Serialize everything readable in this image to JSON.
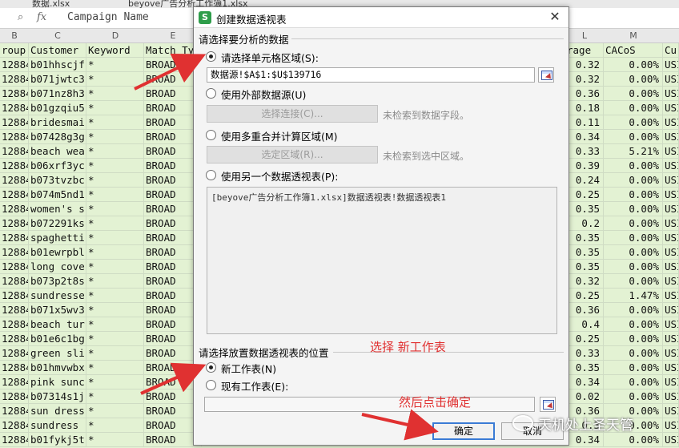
{
  "background": {
    "tabs": [
      "数据.xlsx",
      "beyove广告分析工作簿1.xlsx"
    ],
    "formula_bar": {
      "fx": "fx",
      "content": "Campaign Name"
    },
    "column_letters": [
      "B",
      "C",
      "D",
      "E",
      "L",
      "M"
    ],
    "header_row": [
      "roup",
      "Customer",
      "Keyword",
      "Match Ty",
      "rage",
      "CACoS",
      "Cu"
    ],
    "rows": [
      [
        "12884",
        "b01hhscjf",
        "*",
        "BROAD",
        "0.32",
        "0.00%",
        "USI"
      ],
      [
        "12884",
        "b071jwtc3",
        "*",
        "BROAD",
        "0.32",
        "0.00%",
        "USI"
      ],
      [
        "12884",
        "b071nz8h3",
        "*",
        "BROAD",
        "0.36",
        "0.00%",
        "USI"
      ],
      [
        "12884",
        "b01gzqiu5",
        "*",
        "BROAD",
        "0.18",
        "0.00%",
        "USI"
      ],
      [
        "12884",
        "bridesmai",
        "*",
        "BROAD",
        "0.11",
        "0.00%",
        "USI"
      ],
      [
        "12884",
        "b07428g3g",
        "*",
        "BROAD",
        "0.34",
        "0.00%",
        "USI"
      ],
      [
        "12884",
        "beach wea",
        "*",
        "BROAD",
        "0.33",
        "5.21%",
        "USI"
      ],
      [
        "12884",
        "b06xrf3yc",
        "*",
        "BROAD",
        "0.39",
        "0.00%",
        "USI"
      ],
      [
        "12884",
        "b073tvzbc",
        "*",
        "BROAD",
        "0.24",
        "0.00%",
        "USI"
      ],
      [
        "12884",
        "b074m5nd1",
        "*",
        "BROAD",
        "0.25",
        "0.00%",
        "USI"
      ],
      [
        "12884",
        "women's s",
        "*",
        "BROAD",
        "0.35",
        "0.00%",
        "USI"
      ],
      [
        "12884",
        "b072291ks",
        "*",
        "BROAD",
        "0.2",
        "0.00%",
        "USI"
      ],
      [
        "12884",
        "spaghetti",
        "*",
        "BROAD",
        "0.35",
        "0.00%",
        "USI"
      ],
      [
        "12884",
        "b01ewrpbl",
        "*",
        "BROAD",
        "0.35",
        "0.00%",
        "USI"
      ],
      [
        "12884",
        "long cove",
        "*",
        "BROAD",
        "0.35",
        "0.00%",
        "USI"
      ],
      [
        "12884",
        "b073p2t8s",
        "*",
        "BROAD",
        "0.32",
        "0.00%",
        "USI"
      ],
      [
        "12884",
        "sundresse",
        "*",
        "BROAD",
        "0.25",
        "1.47%",
        "USI"
      ],
      [
        "12884",
        "b071x5wv3",
        "*",
        "BROAD",
        "0.36",
        "0.00%",
        "USI"
      ],
      [
        "12884",
        "beach tur",
        "*",
        "BROAD",
        "0.4",
        "0.00%",
        "USI"
      ],
      [
        "12884",
        "b01e6c1bg",
        "*",
        "BROAD",
        "0.25",
        "0.00%",
        "USI"
      ],
      [
        "12884",
        "green sli",
        "*",
        "BROAD",
        "0.33",
        "0.00%",
        "USI"
      ],
      [
        "12884",
        "b01hmvwbx",
        "*",
        "BROAD",
        "0.35",
        "0.00%",
        "USI"
      ],
      [
        "12884",
        "pink sunc",
        "*",
        "BROAD",
        "0.34",
        "0.00%",
        "USI"
      ],
      [
        "12884",
        "b07314s1j",
        "*",
        "BROAD",
        "0.02",
        "0.00%",
        "USI"
      ],
      [
        "12884",
        "sun dress",
        "*",
        "BROAD",
        "0.36",
        "0.00%",
        "USI"
      ],
      [
        "12884",
        "sundress",
        "*",
        "BROAD",
        "0.3",
        "0.00%",
        "USI"
      ],
      [
        "12884",
        "b01fykj5t",
        "*",
        "BROAD",
        "0.34",
        "0.00%",
        "USI"
      ]
    ]
  },
  "dialog": {
    "icon_letter": "S",
    "title": "创建数据透视表",
    "close_glyph": "✕",
    "section1_label": "请选择要分析的数据",
    "opt_range_label": "请选择单元格区域(S):",
    "range_value": "数据源!$A$1:$U$139716",
    "opt_external_label": "使用外部数据源(U)",
    "btn_select_connection": "选择连接(C)...",
    "hint_no_fields": "未检索到数据字段。",
    "opt_multi_label": "使用多重合并计算区域(M)",
    "btn_select_region": "选定区域(R)...",
    "hint_no_region": "未检索到选中区域。",
    "opt_other_pivot_label": "使用另一个数据透视表(P):",
    "pivot_list": [
      "[beyove广告分析工作簿1.xlsx]数据透视表!数据透视表1"
    ],
    "section2_label": "请选择放置数据透视表的位置",
    "opt_new_sheet_label": "新工作表(N)",
    "opt_existing_sheet_label": "现有工作表(E):",
    "existing_value": "",
    "ok_label": "确定",
    "cancel_label": "取消"
  },
  "annotations": {
    "choose_new_sheet": "选择 新工作表",
    "then_click_ok": "然后点击确定",
    "arrow_color": "#e03131"
  },
  "watermark": "天机处上圣天管"
}
